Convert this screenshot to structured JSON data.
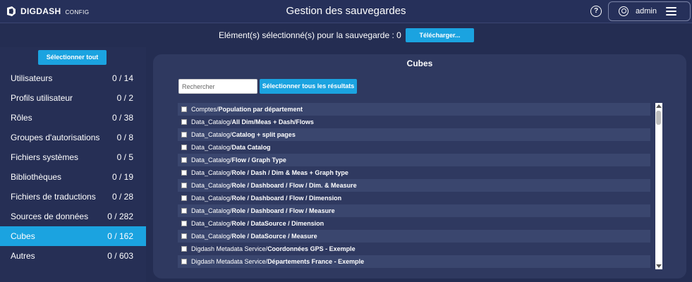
{
  "header": {
    "logo_text": "DIGDASH",
    "logo_sub": "CONFIG",
    "title": "Gestion des sauvegardes",
    "help_glyph": "?",
    "user_name": "admin"
  },
  "selection": {
    "label": "Elément(s) sélectionné(s) pour la sauvegarde : 0",
    "download_label": "Télécharger..."
  },
  "sidebar": {
    "select_all_label": "Sélectionner tout",
    "items": [
      {
        "name": "Utilisateurs",
        "count": "0 / 14"
      },
      {
        "name": "Profils utilisateur",
        "count": "0 / 2"
      },
      {
        "name": "Rôles",
        "count": "0 / 38"
      },
      {
        "name": "Groupes d'autorisations",
        "count": "0 / 8"
      },
      {
        "name": "Fichiers systèmes",
        "count": "0 / 5"
      },
      {
        "name": "Bibliothèques",
        "count": "0 / 19"
      },
      {
        "name": "Fichiers de traductions",
        "count": "0 / 28"
      },
      {
        "name": "Sources de données",
        "count": "0 / 282"
      },
      {
        "name": "Cubes",
        "count": "0 / 162"
      },
      {
        "name": "Autres",
        "count": "0 / 603"
      }
    ],
    "active_index": 8
  },
  "panel": {
    "title": "Cubes",
    "search_placeholder": "Rechercher",
    "select_results_label": "Sélectionner tous les résultats",
    "rows": [
      {
        "path": "Comptes/",
        "leaf": "Population par département"
      },
      {
        "path": "Data_Catalog/",
        "leaf": "All Dim/Meas + Dash/Flows"
      },
      {
        "path": "Data_Catalog/",
        "leaf": "Catalog + split pages"
      },
      {
        "path": "Data_Catalog/",
        "leaf": "Data Catalog"
      },
      {
        "path": "Data_Catalog/",
        "leaf": "Flow / Graph Type"
      },
      {
        "path": "Data_Catalog/",
        "leaf": "Role / Dash / Dim & Meas + Graph type"
      },
      {
        "path": "Data_Catalog/",
        "leaf": "Role / Dashboard / Flow / Dim. & Measure"
      },
      {
        "path": "Data_Catalog/",
        "leaf": "Role / Dashboard / Flow / Dimension"
      },
      {
        "path": "Data_Catalog/",
        "leaf": "Role / Dashboard / Flow / Measure"
      },
      {
        "path": "Data_Catalog/",
        "leaf": "Role / DataSource / Dimension"
      },
      {
        "path": "Data_Catalog/",
        "leaf": "Role / DataSource / Measure"
      },
      {
        "path": "Digdash Metadata Service/",
        "leaf": "Coordonnées GPS - Exemple"
      },
      {
        "path": "Digdash Metadata Service/",
        "leaf": "Départements France - Exemple"
      }
    ]
  },
  "colors": {
    "background": "#242d52",
    "panel": "#2f3960",
    "accent": "#1ba3e0",
    "row_alt": "#3a466e"
  }
}
